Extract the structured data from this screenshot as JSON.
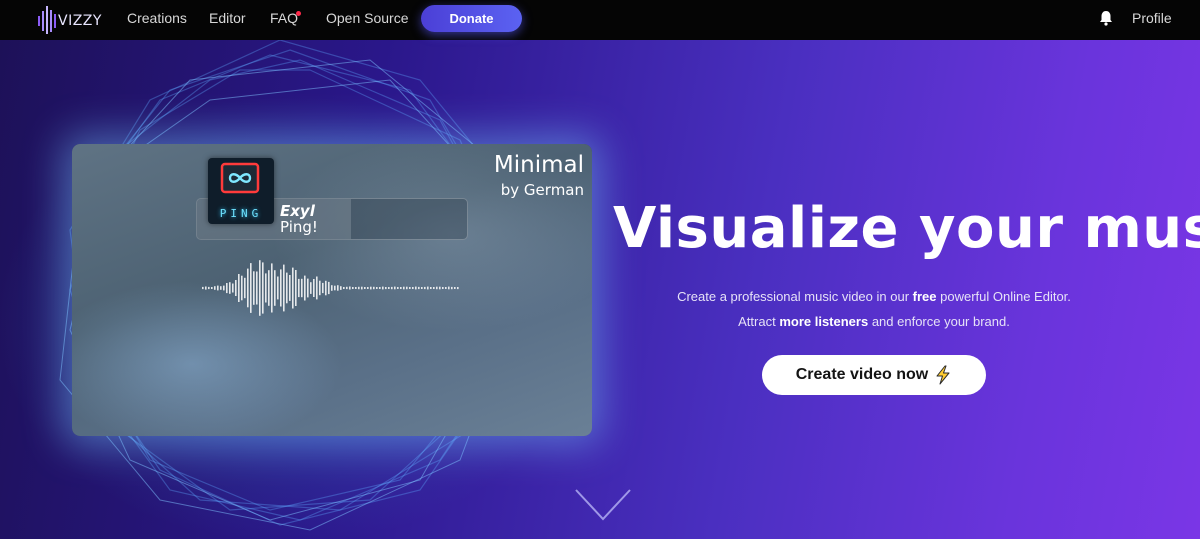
{
  "nav": {
    "logo_text": "VIZZY",
    "links": [
      "Creations",
      "Editor",
      "FAQ",
      "Open Source"
    ],
    "donate_label": "Donate",
    "profile_label": "Profile",
    "notification_dot_color": "#ff2a4a"
  },
  "preview": {
    "template_name": "Minimal",
    "template_author": "by German",
    "track_artist": "Exyl",
    "track_name": "Ping!",
    "cover_label": "PING"
  },
  "hero": {
    "headline": "Visualize your music",
    "line1_pre": "Create a professional music video in our ",
    "line1_bold": "free",
    "line1_post": " powerful Online Editor.",
    "line2_pre": "Attract ",
    "line2_bold": "more listeners",
    "line2_post": " and enforce your brand.",
    "cta_label": "Create video now",
    "cta_icon": "lightning-icon",
    "scroll_icon": "chevron-down-icon"
  },
  "colors": {
    "nav_bg": "#050505",
    "donate_bg": "#5b62f2",
    "accent_purple": "#7a36e6",
    "cta_bg": "#ffffff"
  }
}
